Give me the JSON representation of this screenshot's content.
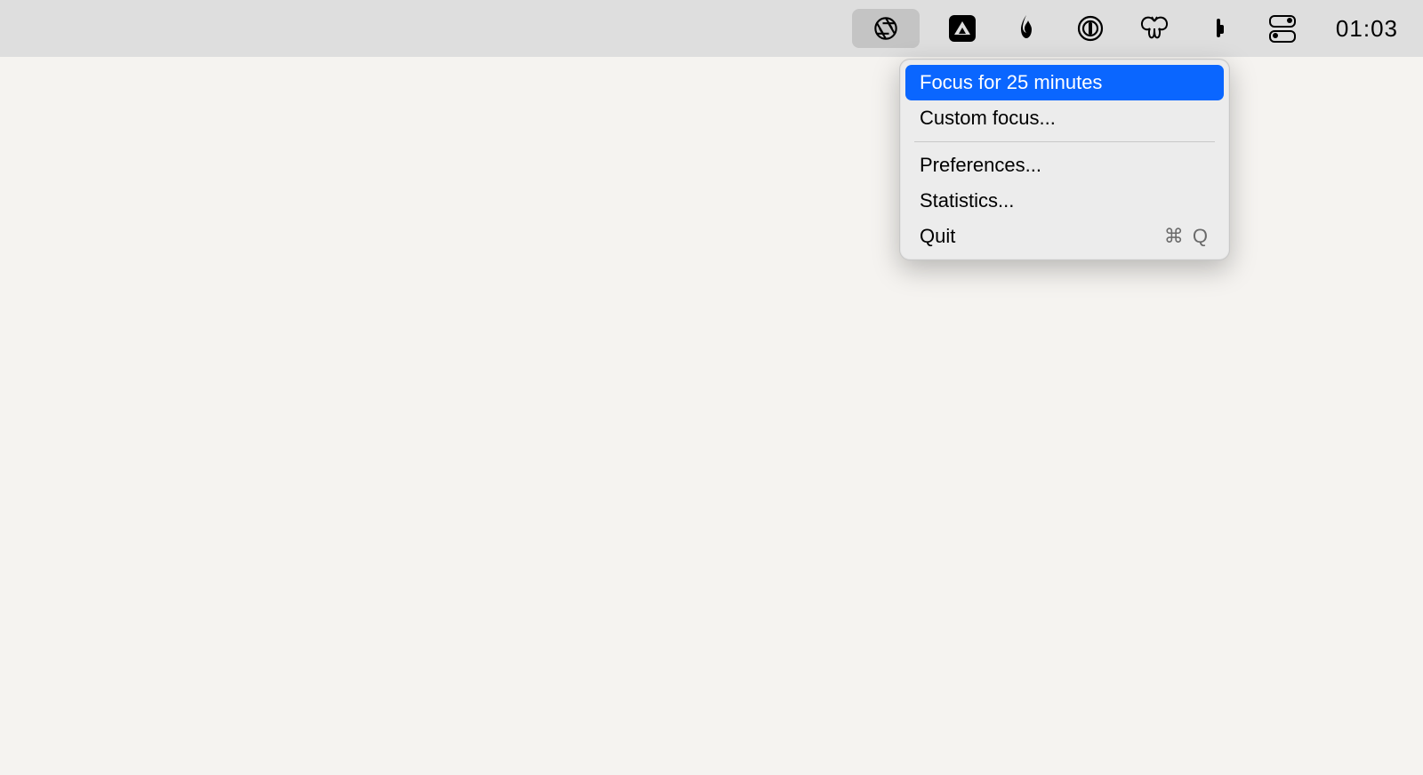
{
  "menubar": {
    "clock": "01:03",
    "icons": {
      "focus": "aperture-icon",
      "triangle": "triangle-icon",
      "flame": "flame-icon",
      "onepass": "onepassword-icon",
      "butterfly": "butterfly-icon",
      "battery": "battery-icon",
      "control": "control-center-icon"
    }
  },
  "dropdown": {
    "items": [
      {
        "label": "Focus for 25 minutes",
        "shortcut": "",
        "highlight": true
      },
      {
        "label": "Custom focus...",
        "shortcut": ""
      }
    ],
    "items2": [
      {
        "label": "Preferences...",
        "shortcut": ""
      },
      {
        "label": "Statistics...",
        "shortcut": ""
      },
      {
        "label": "Quit",
        "shortcut": "⌘ Q"
      }
    ]
  }
}
